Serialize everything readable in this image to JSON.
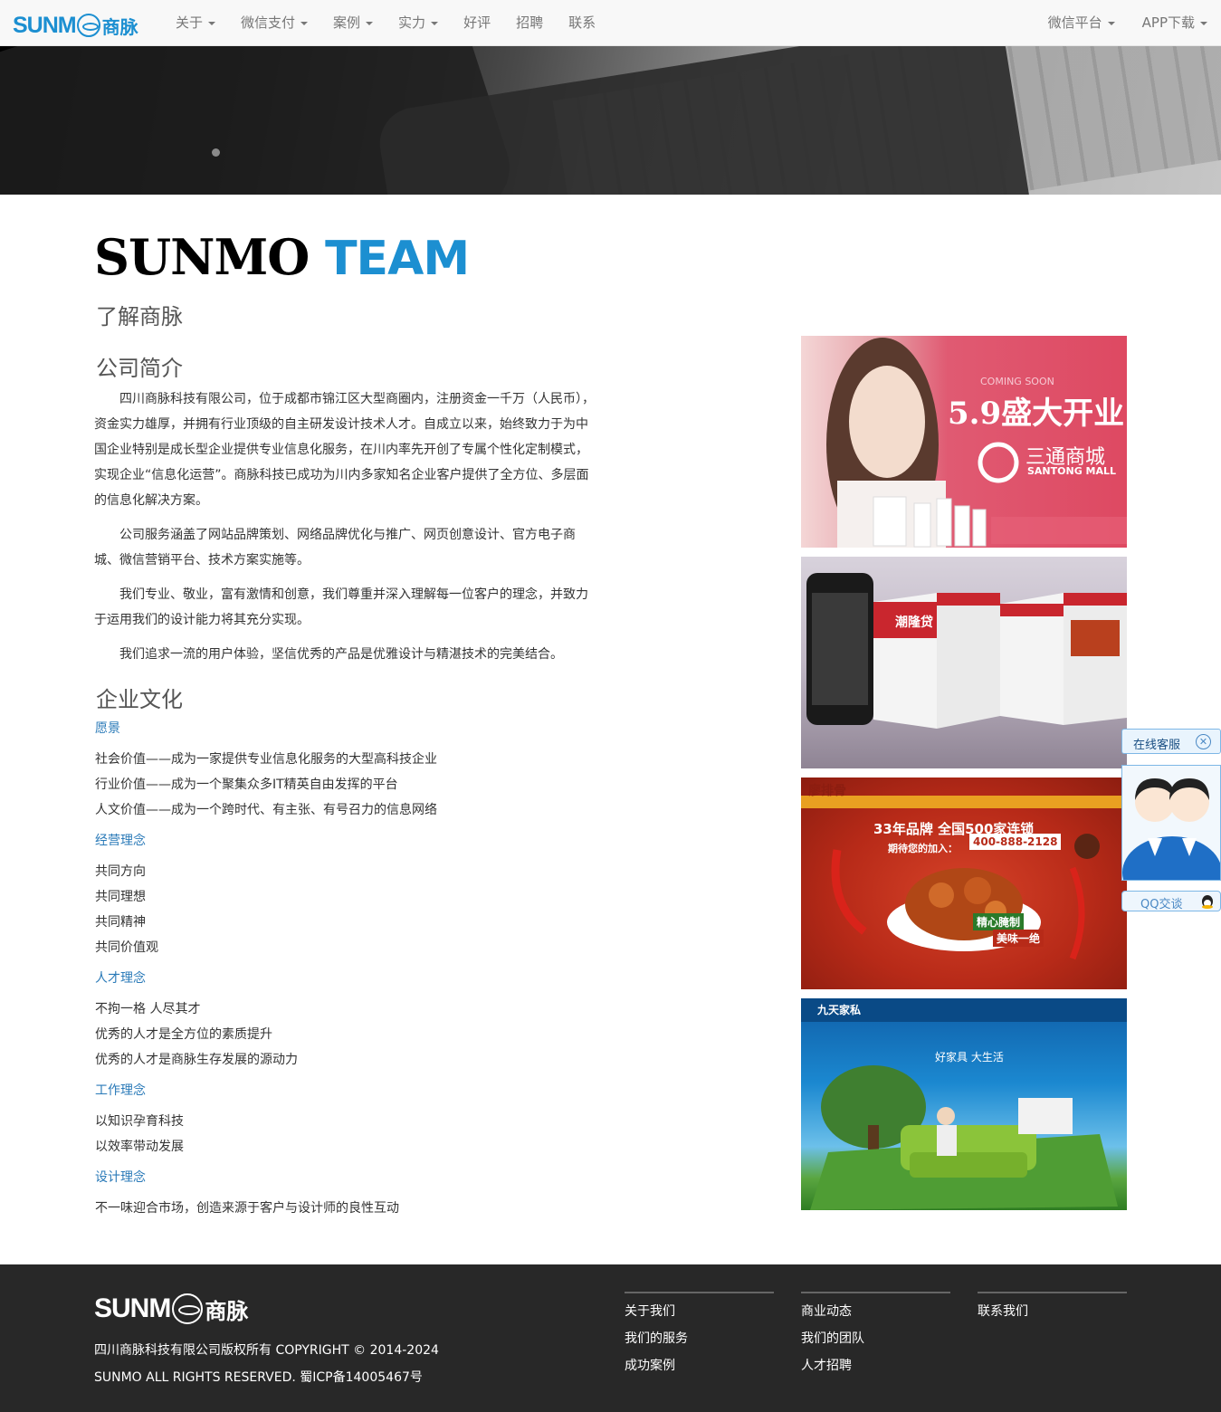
{
  "navbar": {
    "logo_text": "SUNM",
    "logo_cn": "商脉",
    "left_items": [
      {
        "label": "关于",
        "dropdown": true
      },
      {
        "label": "微信支付",
        "dropdown": true
      },
      {
        "label": "案例",
        "dropdown": true
      },
      {
        "label": "实力",
        "dropdown": true
      },
      {
        "label": "好评",
        "dropdown": false
      },
      {
        "label": "招聘",
        "dropdown": false
      },
      {
        "label": "联系",
        "dropdown": false
      }
    ],
    "right_items": [
      {
        "label": "微信平台",
        "dropdown": true
      },
      {
        "label": "APP下载",
        "dropdown": true
      }
    ]
  },
  "main": {
    "title_part1": "SUNMO",
    "title_part2": "TEAM",
    "subtitle": "了解商脉",
    "intro_heading": "公司简介",
    "intro_paragraphs": [
      "四川商脉科技有限公司，位于成都市锦江区大型商圈内，注册资金一千万（人民币），资金实力雄厚，并拥有行业顶级的自主研发设计技术人才。自成立以来，始终致力于为中国企业特别是成长型企业提供专业信息化服务，在川内率先开创了专属个性化定制模式，实现企业“信息化运营”。商脉科技已成功为川内多家知名企业客户提供了全方位、多层面的信息化解决方案。",
      "公司服务涵盖了网站品牌策划、网络品牌优化与推广、网页创意设计、官方电子商城、微信营销平台、技术方案实施等。",
      "我们专业、敬业，富有激情和创意，我们尊重并深入理解每一位客户的理念，并致力于运用我们的设计能力将其充分实现。",
      "我们追求一流的用户体验，坚信优秀的产品是优雅设计与精湛技术的完美结合。"
    ],
    "culture_heading": "企业文化",
    "culture_sections": [
      {
        "title": "愿景",
        "lines": [
          "社会价值——成为一家提供专业信息化服务的大型高科技企业",
          "行业价值——成为一个聚集众多IT精英自由发挥的平台",
          "人文价值——成为一个跨时代、有主张、有号召力的信息网络"
        ]
      },
      {
        "title": "经营理念",
        "lines": [
          "共同方向",
          "共同理想",
          "共同精神",
          "共同价值观"
        ]
      },
      {
        "title": "人才理念",
        "lines": [
          "不拘一格 人尽其才",
          "优秀的人才是全方位的素质提升",
          "优秀的人才是商脉生存发展的源动力"
        ]
      },
      {
        "title": "工作理念",
        "lines": [
          "以知识孕育科技",
          "以效率带动发展"
        ]
      },
      {
        "title": "设计理念",
        "lines": [
          "不一味迎合市场，创造来源于客户与设计师的良性互动"
        ]
      }
    ]
  },
  "gallery": {
    "pic1": {
      "tagline": "COMING SOON",
      "headline": "5.9盛大开业",
      "brand_cn": "三通商城",
      "brand_en": "SANTONG MALL"
    },
    "pic2": {
      "brand": "潮隆贷"
    },
    "pic3": {
      "brand": "廖排骨",
      "slogan": "33年品牌 全国500家连锁",
      "join": "期待您的加入：",
      "phone": "400-888-2128",
      "badge1": "精心腌制",
      "badge2": "美味一绝"
    },
    "pic4": {
      "brand": "九天家私",
      "slogan": "好家具 大生活"
    }
  },
  "qq_widget": {
    "header": "在线客服",
    "close_icon": "close-icon",
    "button": "QQ交谈"
  },
  "footer": {
    "logo_text": "SUNM",
    "logo_cn": "商脉",
    "copyright_line1": "四川商脉科技有限公司版权所有 COPYRIGHT © 2014-2024",
    "copyright_line2": "SUNMO ALL RIGHTS RESERVED. 蜀ICP备14005467号",
    "columns": [
      [
        "关于我们",
        "我们的服务",
        "成功案例"
      ],
      [
        "商业动态",
        "我们的团队",
        "人才招聘"
      ],
      [
        "联系我们"
      ]
    ]
  },
  "colors": {
    "accent": "#1c8fd1",
    "link": "#2a7ab8",
    "footer_bg": "#282828",
    "navbar_bg": "#f8f8f8"
  }
}
